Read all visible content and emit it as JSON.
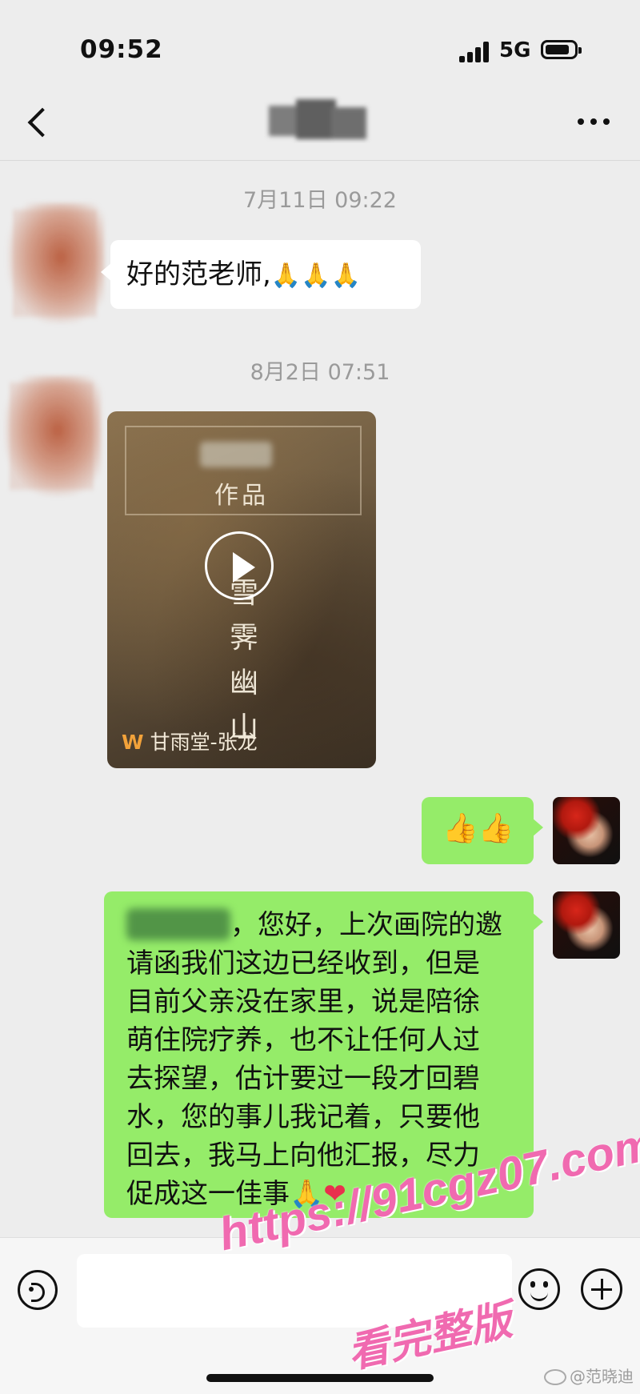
{
  "status_bar": {
    "time": "09:52",
    "network": "5G"
  },
  "header": {
    "title_redacted": true
  },
  "messages": [
    {
      "type": "timestamp",
      "text": "7月11日 09:22"
    },
    {
      "type": "text",
      "from": "other",
      "text": "好的范老师,",
      "emoji": "🙏🙏🙏"
    },
    {
      "type": "timestamp",
      "text": "8月2日 07:51"
    },
    {
      "type": "video",
      "from": "other",
      "label": "作品",
      "title_chars": [
        "雪",
        "霁",
        "幽",
        "山"
      ],
      "source": "甘雨堂-张龙",
      "source_icon": "channels-icon"
    },
    {
      "type": "text",
      "from": "me",
      "text": "👍👍"
    },
    {
      "type": "text",
      "from": "me",
      "lines": [
        "，您好，上次画院的邀",
        "请函我们这边已经收到，但是",
        "目前父亲没在家里，说是陪徐",
        "萌住院疗养，也不让任何人过",
        "去探望，估计要过一段才回碧",
        "水，您的事儿我记着，只要他",
        "回去，我马上向他汇报，尽力",
        "促成这一佳事"
      ],
      "emoji_end": "🙏",
      "heart": "❤"
    }
  ],
  "input_bar": {
    "placeholder": ""
  },
  "watermark": {
    "url": "https://91cgz07.com",
    "cta": "看完整版",
    "weibo_handle": "@范晓迪"
  }
}
